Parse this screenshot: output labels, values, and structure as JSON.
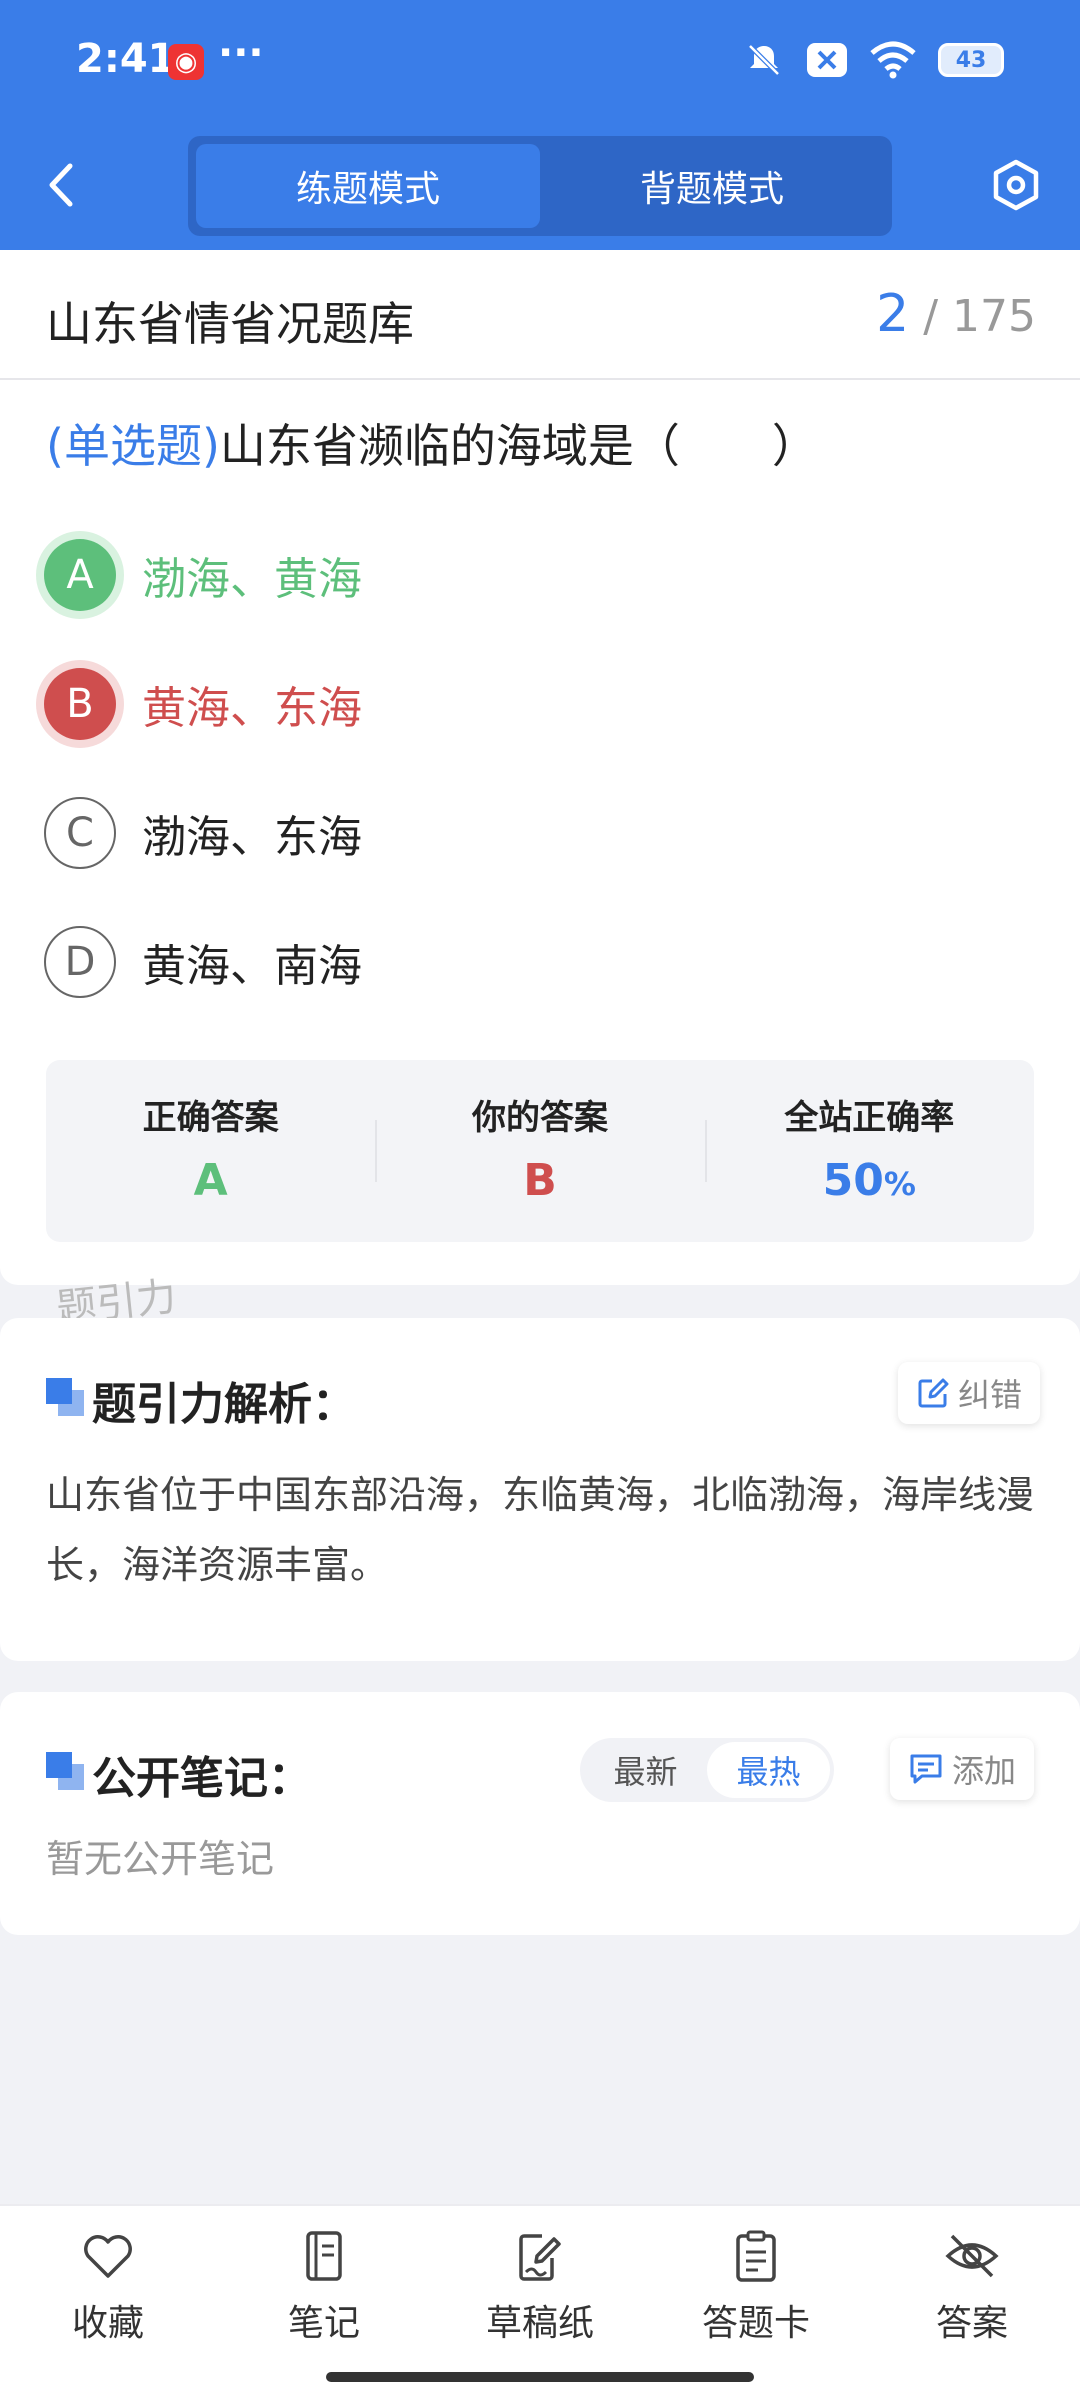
{
  "status": {
    "time": "2:41",
    "dots": "···",
    "battery": "43",
    "app_badge": "◉"
  },
  "header": {
    "tabs": [
      {
        "label": "练题模式",
        "active": true
      },
      {
        "label": "背题模式",
        "active": false
      }
    ]
  },
  "bank": {
    "title": "山东省情省况题库",
    "current": "2",
    "total": "/ 175"
  },
  "question": {
    "type": "(单选题)",
    "text": "山东省濒临的海域是（　　）",
    "options": [
      {
        "letter": "A",
        "text": "渤海、黄海",
        "state": "correct"
      },
      {
        "letter": "B",
        "text": "黄海、东海",
        "state": "wrong"
      },
      {
        "letter": "C",
        "text": "渤海、东海",
        "state": "normal"
      },
      {
        "letter": "D",
        "text": "黄海、南海",
        "state": "normal"
      }
    ]
  },
  "result": {
    "correct_label": "正确答案",
    "correct_value": "A",
    "yours_label": "你的答案",
    "yours_value": "B",
    "rate_label": "全站正确率",
    "rate_value": "50",
    "rate_unit": "%"
  },
  "watermark": "题引力",
  "analysis": {
    "title": "题引力解析：",
    "fix_label": "纠错",
    "text": "山东省位于中国东部沿海，东临黄海，北临渤海，海岸线漫长，海洋资源丰富。"
  },
  "notes": {
    "title": "公开笔记：",
    "sort_newest": "最新",
    "sort_hottest": "最热",
    "add_label": "添加",
    "empty_text": "暂无公开笔记"
  },
  "bottom_nav": [
    {
      "label": "收藏",
      "icon": "heart-icon"
    },
    {
      "label": "笔记",
      "icon": "notebook-icon"
    },
    {
      "label": "草稿纸",
      "icon": "draft-icon"
    },
    {
      "label": "答题卡",
      "icon": "answer-card-icon"
    },
    {
      "label": "答案",
      "icon": "eye-off-icon"
    }
  ],
  "colors": {
    "primary": "#3a7de8",
    "correct": "#5dbf7b",
    "wrong": "#cf4e4e"
  }
}
